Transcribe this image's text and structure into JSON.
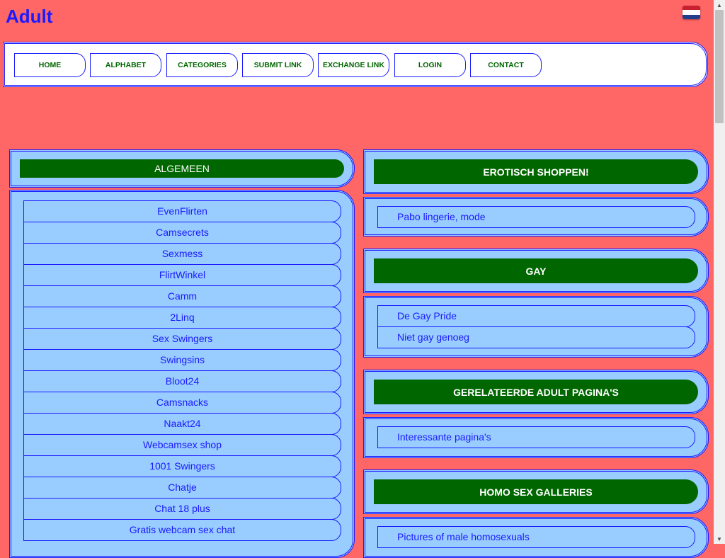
{
  "site": {
    "title": "Adult"
  },
  "language": {
    "flag_icon": "netherlands-flag-icon"
  },
  "nav": [
    {
      "label": "HOME"
    },
    {
      "label": "ALPHABET"
    },
    {
      "label": "CATEGORIES"
    },
    {
      "label": "SUBMIT LINK"
    },
    {
      "label": "EXCHANGE LINK"
    },
    {
      "label": "LOGIN"
    },
    {
      "label": "CONTACT"
    }
  ],
  "left": {
    "title": "ALGEMEEN",
    "links": [
      "EvenFlirten",
      "Camsecrets",
      "Sexmess",
      "FlirtWinkel",
      "Camm",
      "2Linq",
      "Sex Swingers",
      "Swingsins",
      "Bloot24",
      "Camsnacks",
      "Naakt24",
      "Webcamsex shop",
      "1001 Swingers",
      "Chatje",
      "Chat 18 plus",
      "Gratis webcam sex chat"
    ]
  },
  "right": [
    {
      "title": "EROTISCH SHOPPEN!",
      "links": [
        "Pabo lingerie, mode"
      ]
    },
    {
      "title": "GAY",
      "links": [
        "De Gay Pride",
        "Niet gay genoeg"
      ]
    },
    {
      "title": "GERELATEERDE ADULT PAGINA'S",
      "links": [
        "Interessante pagina's"
      ]
    },
    {
      "title": "HOMO SEX GALLERIES",
      "links": [
        "Pictures of male homosexuals"
      ]
    }
  ],
  "colors": {
    "background": "#ff6666",
    "panel": "#99ccff",
    "header": "#006600",
    "link": "#1a1aff",
    "border": "#1a1aff"
  }
}
